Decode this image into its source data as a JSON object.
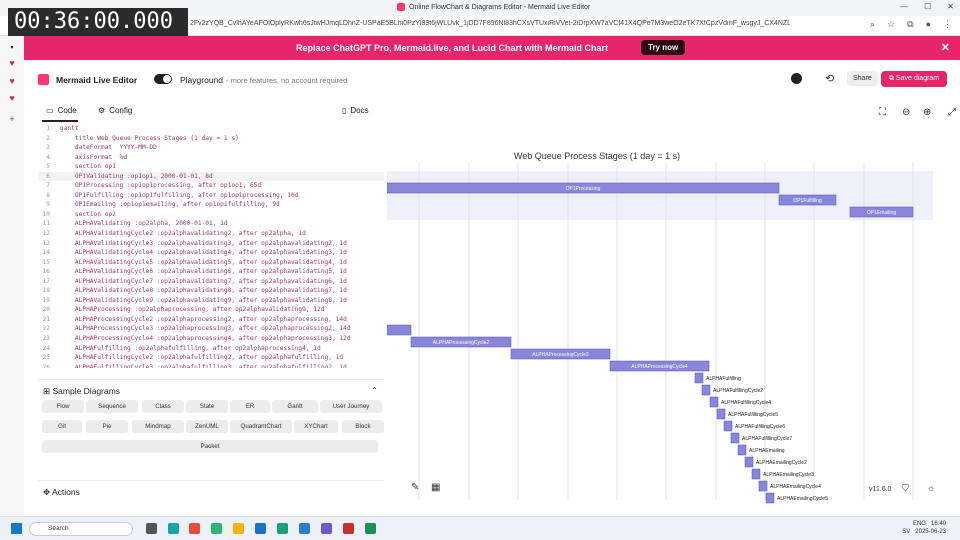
{
  "timer": "00:36:00.000",
  "browser": {
    "tab_title": "Online FlowChart & Diagrams Editor - Mermaid Live Editor",
    "url": "2Fv2zYQB_CvlhAYeAFOlOplyRKwh6sJtwHJmqLDhnZ-USPaE5BLhi0PzYl89t6jWLUvk_1jDD7F896Nl83hCXsVTUxiRiVVet-2iDrpXW7aVCf41X4QPe7M3weO2eTK7XfCpzVdmF_wsgyJ_CX4NZLD7pcl8..."
  },
  "banner": {
    "message": "Replace ChatGPT Pro, Mermaid.live, and Lucid Chart with Mermaid Chart",
    "cta": "Try now"
  },
  "header": {
    "title": "Mermaid Live Editor",
    "playground": "Playground",
    "playground_sub": "- more features, no account required",
    "share": "Share",
    "save": "Save diagram"
  },
  "editor": {
    "tab_code": "Code",
    "tab_config": "Config",
    "docs": "Docs",
    "lines": [
      "gantt",
      "    title Web Queue Process Stages (1 day = 1 s)",
      "    dateFormat  YYYY-MM-DD",
      "    axisFormat  %d",
      "    section op1",
      "    OP1Validating :op1op1, 2000-01-01, 8d",
      "    OP1Processing :op1op1processing, after op1op1, 65d",
      "    OP1Fulfilling :op1op1fulfilling, after op1op1processing, 10d",
      "    OP1Emailing :op1op1emailing, after op1op1fulfilling, 9d",
      "    section op2",
      "    ALPHAValidating :op2alpha, 2000-01-01, 1d",
      "    ALPHAValidatingCycle2 :op2alphavalidating2, after op2alpha, 1d",
      "    ALPHAValidatingCycle3 :op2alphavalidating3, after op2alphavalidating2, 1d",
      "    ALPHAValidatingCycle4 :op2alphavalidating4, after op2alphavalidating3, 1d",
      "    ALPHAValidatingCycle5 :op2alphavalidating5, after op2alphavalidating4, 1d",
      "    ALPHAValidatingCycle6 :op2alphavalidating6, after op2alphavalidating5, 1d",
      "    ALPHAValidatingCycle7 :op2alphavalidating7, after op2alphavalidating6, 1d",
      "    ALPHAValidatingCycle8 :op2alphavalidating8, after op2alphavalidating7, 1d",
      "    ALPHAValidatingCycle9 :op2alphavalidating9, after op2alphavalidating8, 1d",
      "    ALPHAProcessing :op2alphaprocessing, after op2alphavalidating9, 12d",
      "    ALPHAProcessingCycle2 :op2alphaprocessing2, after op2alphaprocessing, 14d",
      "    ALPHAProcessingCycle3 :op2alphaprocessing3, after op2alphaprocessing2, 14d",
      "    ALPHAProcessingCycle4 :op2alphaprocessing4, after op2alphaprocessing3, 12d",
      "    ALPHAFulfilling :op2alphafulfilling, after op2alphaprocessing4, 1d",
      "    ALPHAFulfillingCycle2 :op2alphafulfilling2, after op2alphafulfilling, 1d",
      "    ALPHAFulfillingCycle3 :op2alphafulfilling3, after op2alphafulfilling2, 1d"
    ]
  },
  "samples": {
    "title": "Sample Diagrams",
    "items": [
      "Flow",
      "Sequence",
      "Class",
      "State",
      "ER",
      "Gantt",
      "User Journey",
      "Git",
      "Pie",
      "Mindmap",
      "ZenUML",
      "QuadrantChart",
      "XYChart",
      "Block",
      "Packet"
    ]
  },
  "actions": {
    "title": "Actions"
  },
  "diagram": {
    "title": "Web Queue Process Stages (1 day = 1 s)",
    "version": "v11.6.0",
    "bar_color": "#8a86d8",
    "tasks": [
      {
        "label": "OP1Processing"
      },
      {
        "label": "OP1Fulfilling"
      },
      {
        "label": "OP1Emailing"
      },
      {
        "label": "ALPHAProcessingCycle2"
      },
      {
        "label": "ALPHAProcessingCycle3"
      },
      {
        "label": "ALPHAProcessingCycle4"
      },
      {
        "label": "ALPHAFulfilling"
      },
      {
        "label": "ALPHAFulfillingCycle2"
      },
      {
        "label": "ALPHAFulfillingCycle4"
      },
      {
        "label": "ALPHAFulfillingCycle5"
      },
      {
        "label": "ALPHAFulfillingCycle6"
      },
      {
        "label": "ALPHAFulfillingCycle7"
      },
      {
        "label": "ALPHAEmailing"
      },
      {
        "label": "ALPHAEmailingCycle2"
      },
      {
        "label": "ALPHAEmailingCycle3"
      },
      {
        "label": "ALPHAEmailingCycle4"
      },
      {
        "label": "ALPHAEmailingCycle5"
      }
    ]
  },
  "taskbar": {
    "search": "Search",
    "lang1": "ENG",
    "lang2": "SV",
    "time": "16:40",
    "date": "2025-06-23"
  }
}
